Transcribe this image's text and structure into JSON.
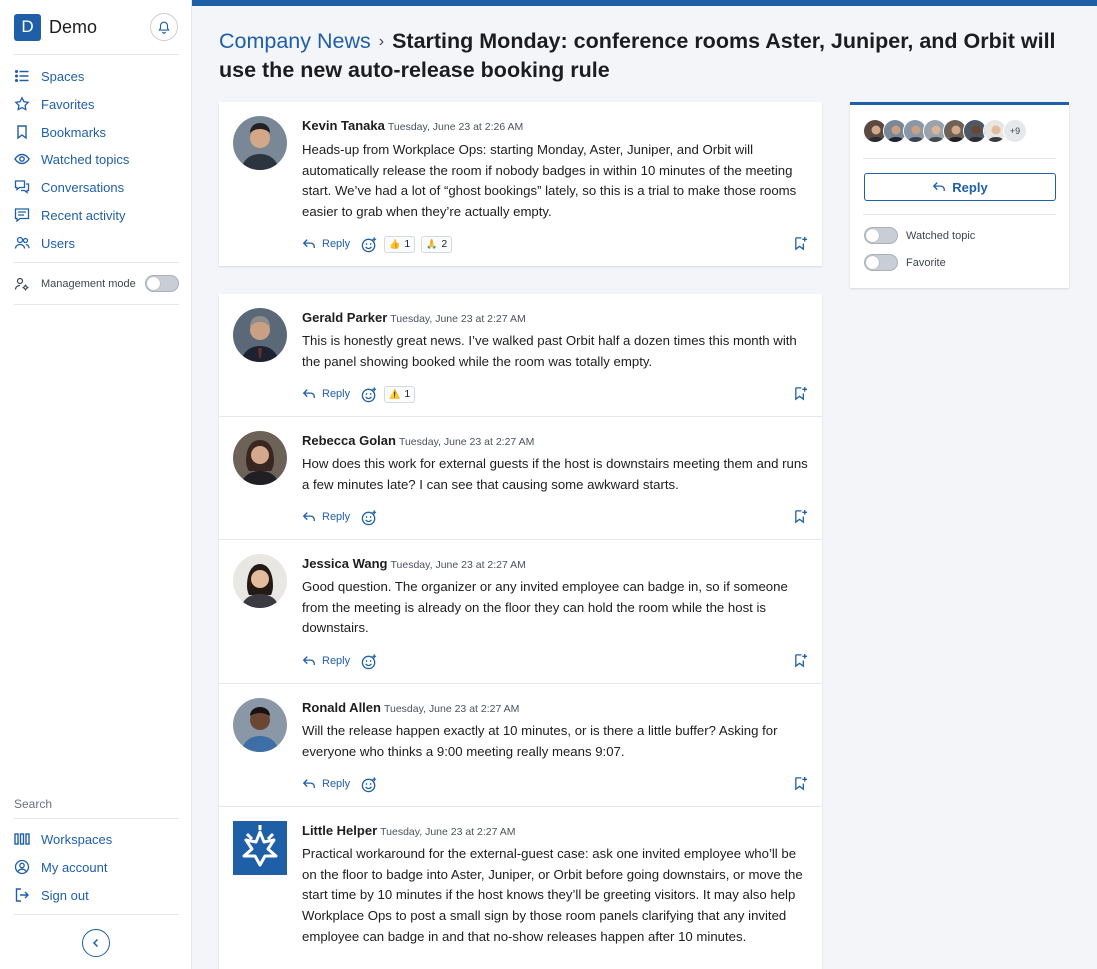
{
  "app": {
    "logo_letter": "D",
    "name": "Demo"
  },
  "sidebar": {
    "items": [
      {
        "label": "Spaces",
        "icon": "list-icon"
      },
      {
        "label": "Favorites",
        "icon": "star-icon"
      },
      {
        "label": "Bookmarks",
        "icon": "bookmark-icon"
      },
      {
        "label": "Watched topics",
        "icon": "eye-icon"
      },
      {
        "label": "Conversations",
        "icon": "conversations-icon"
      },
      {
        "label": "Recent activity",
        "icon": "activity-icon"
      },
      {
        "label": "Users",
        "icon": "users-icon"
      }
    ],
    "management_mode": "Management mode",
    "search_label": "Search",
    "bottom_items": [
      {
        "label": "Workspaces",
        "icon": "workspaces-icon"
      },
      {
        "label": "My account",
        "icon": "account-icon"
      },
      {
        "label": "Sign out",
        "icon": "sign-out-icon"
      }
    ]
  },
  "header": {
    "breadcrumb": "Company News",
    "title": "Starting Monday: conference rooms Aster, Juniper, and Orbit will use the new auto-release booking rule"
  },
  "reply_label": "Reply",
  "posts": [
    {
      "author": "Kevin Tanaka",
      "date": "Tuesday, June 23 at 2:26 AM",
      "body": "Heads-up from Workplace Ops: starting Monday, Aster, Juniper, and Orbit will automatically release the room if nobody badges in within 10 minutes of the meeting start. We’ve had a lot of “ghost bookings” lately, so this is a trial to make those rooms easier to grab when they’re actually empty.",
      "reactions": [
        {
          "emoji": "👍",
          "count": "1"
        },
        {
          "emoji": "🙏",
          "count": "2"
        }
      ]
    },
    {
      "author": "Gerald Parker",
      "date": "Tuesday, June 23 at 2:27 AM",
      "body": "This is honestly great news. I’ve walked past Orbit half a dozen times this month with the panel showing booked while the room was totally empty.",
      "reactions": [
        {
          "emoji": "⚠️",
          "count": "1"
        }
      ]
    },
    {
      "author": "Rebecca Golan",
      "date": "Tuesday, June 23 at 2:27 AM",
      "body": "How does this work for external guests if the host is downstairs meeting them and runs a few minutes late? I can see that causing some awkward starts.",
      "reactions": []
    },
    {
      "author": "Jessica Wang",
      "date": "Tuesday, June 23 at 2:27 AM",
      "body": "Good question. The organizer or any invited employee can badge in, so if someone from the meeting is already on the floor they can hold the room while the host is downstairs.",
      "reactions": []
    },
    {
      "author": "Ronald Allen",
      "date": "Tuesday, June 23 at 2:27 AM",
      "body": "Will the release happen exactly at 10 minutes, or is there a little buffer? Asking for everyone who thinks a 9:00 meeting really means 9:07.",
      "reactions": []
    },
    {
      "author": "Little Helper",
      "date": "Tuesday, June 23 at 2:27 AM",
      "body": "Practical workaround for the external-guest case: ask one invited employee who’ll be on the floor to badge into Aster, Juniper, or Orbit before going downstairs, or move the start time by 10 minutes if the host knows they’ll be greeting visitors. It may also help Workplace Ops to post a small sign by those room panels clarifying that any invited employee can badge in and that no-show releases happen after 10 minutes.",
      "reactions": []
    }
  ],
  "panel": {
    "more_participants": "+9",
    "reply_label": "Reply",
    "watched_topic": "Watched topic",
    "favorite": "Favorite"
  },
  "colors": {
    "accent": "#1f5fa8"
  }
}
